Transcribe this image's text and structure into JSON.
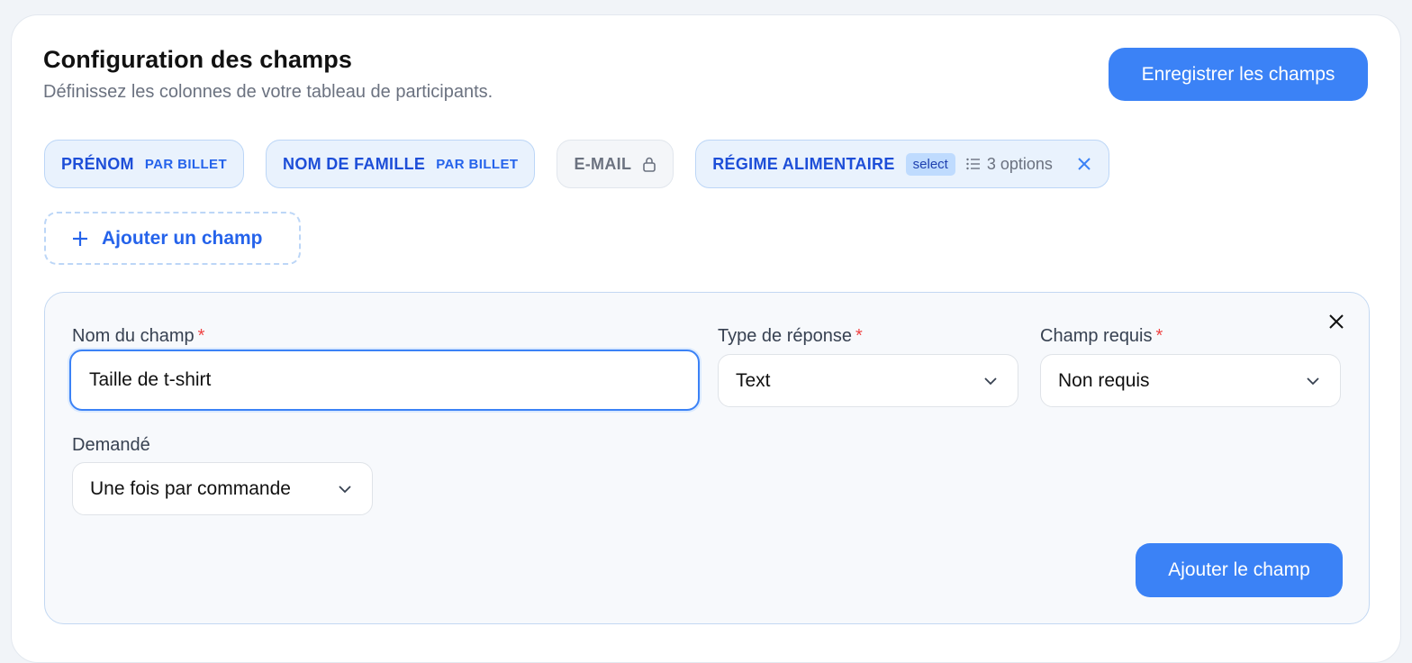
{
  "header": {
    "title": "Configuration des champs",
    "subtitle": "Définissez les colonnes de votre tableau de participants.",
    "save_label": "Enregistrer les champs"
  },
  "fields": [
    {
      "label": "PRÉNOM",
      "sub": "PAR BILLET"
    },
    {
      "label": "NOM DE FAMILLE",
      "sub": "PAR BILLET"
    },
    {
      "label": "E-MAIL",
      "icon": "lock-icon"
    },
    {
      "label": "RÉGIME ALIMENTAIRE",
      "type": "select",
      "options": "3 options",
      "icon": "close-icon"
    }
  ],
  "add_field_label": "Ajouter un champ",
  "form": {
    "name_label": "Nom du champ",
    "name_value": "Taille de t-shirt",
    "type_label": "Type de réponse",
    "type_value": "Text",
    "required_label": "Champ requis",
    "required_value": "Non requis",
    "asked_label": "Demandé",
    "asked_value": "Une fois par commande",
    "required_marker": "*",
    "submit_label": "Ajouter le champ"
  },
  "colors": {
    "accent": "#3b82f6",
    "chip_bg": "#e9f2fd",
    "chip_text": "#1d4ed8",
    "required": "#ef4444"
  }
}
